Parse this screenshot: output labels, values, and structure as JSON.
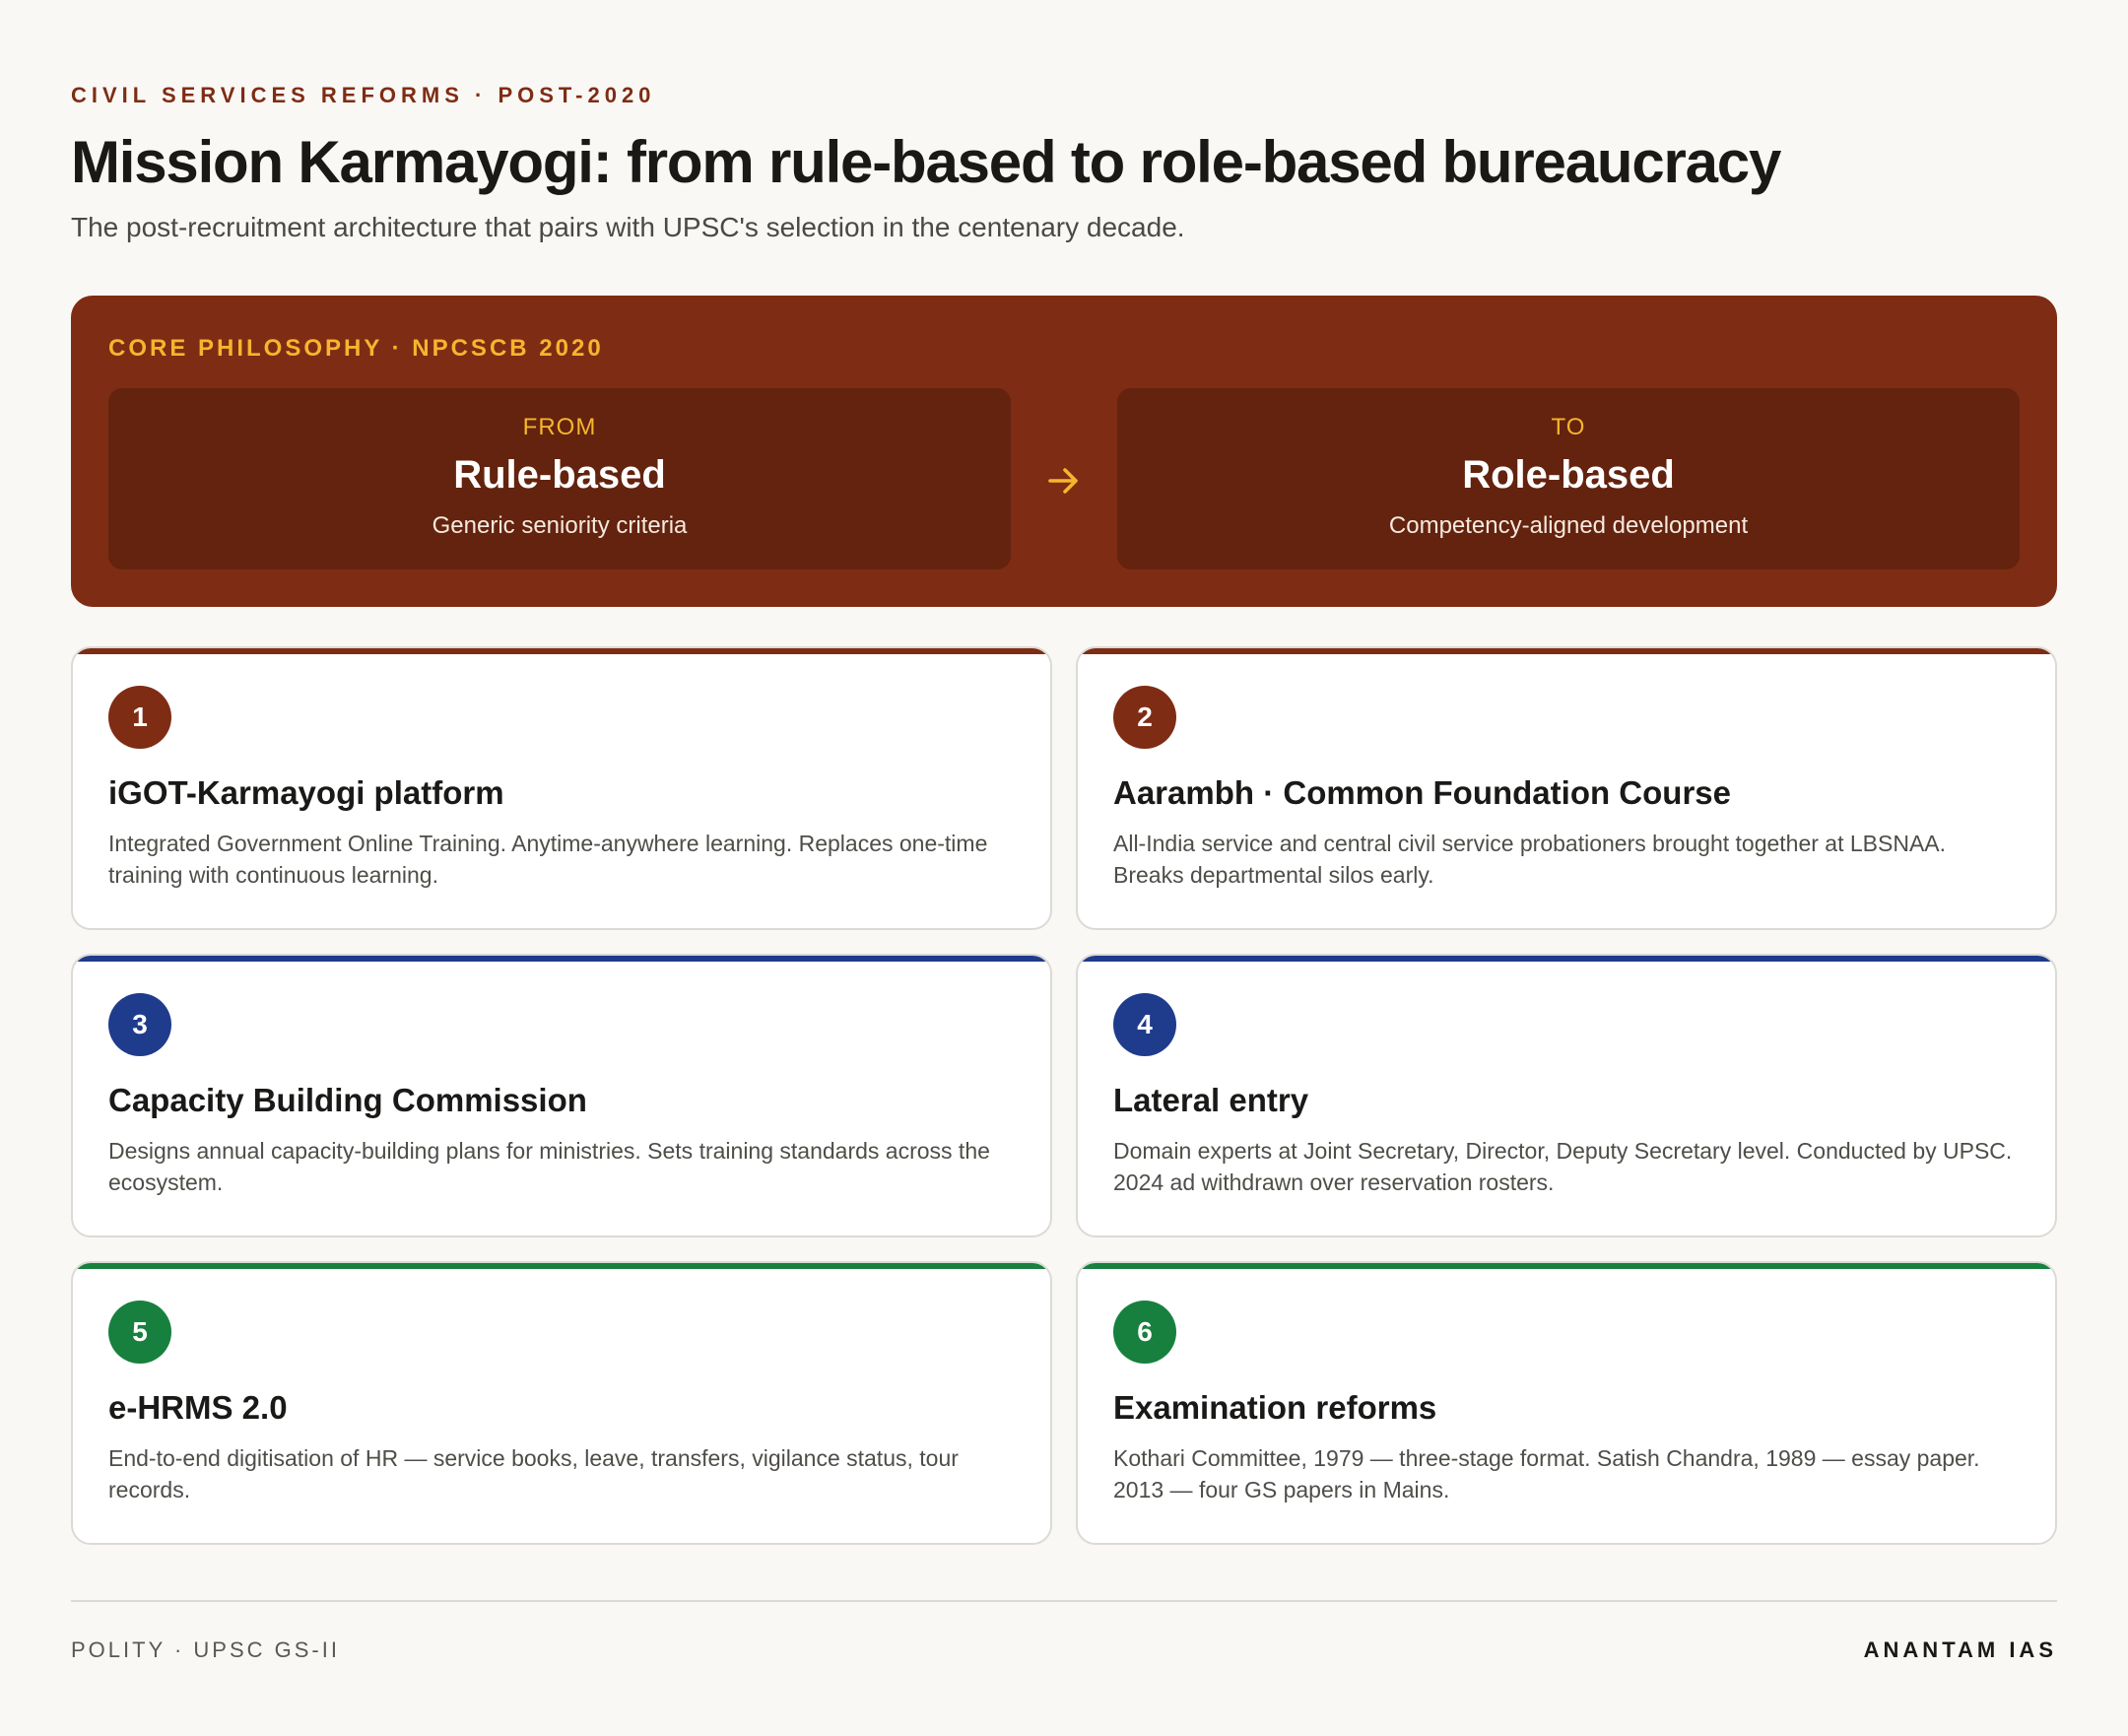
{
  "header": {
    "eyebrow": "CIVIL SERVICES REFORMS · POST-2020",
    "title": "Mission Karmayogi: from rule-based to role-based bureaucracy",
    "subtitle": "The post-recruitment architecture that pairs with UPSC's selection in the centenary decade."
  },
  "banner": {
    "label": "CORE PHILOSOPHY · NPCSCB 2020",
    "from": {
      "tag": "FROM",
      "main": "Rule-based",
      "desc": "Generic seniority criteria"
    },
    "to": {
      "tag": "TO",
      "main": "Role-based",
      "desc": "Competency-aligned development"
    },
    "arrow_icon": "arrow-right-icon"
  },
  "colors": {
    "maroon": "#7f2c14",
    "blue": "#1f3b8c",
    "green": "#17803e",
    "gold": "#f6b52e"
  },
  "cards": [
    {
      "num": "1",
      "title": "iGOT-Karmayogi platform",
      "desc": "Integrated Government Online Training. Anytime-anywhere learning. Replaces one-time training with continuous learning.",
      "accent": "#7f2c14"
    },
    {
      "num": "2",
      "title": "Aarambh · Common Foundation Course",
      "desc": "All-India service and central civil service probationers brought together at LBSNAA. Breaks departmental silos early.",
      "accent": "#7f2c14"
    },
    {
      "num": "3",
      "title": "Capacity Building Commission",
      "desc": "Designs annual capacity-building plans for ministries. Sets training standards across the ecosystem.",
      "accent": "#1f3b8c"
    },
    {
      "num": "4",
      "title": "Lateral entry",
      "desc": "Domain experts at Joint Secretary, Director, Deputy Secretary level. Conducted by UPSC. 2024 ad withdrawn over reservation rosters.",
      "accent": "#1f3b8c"
    },
    {
      "num": "5",
      "title": "e-HRMS 2.0",
      "desc": "End-to-end digitisation of HR — service books, leave, transfers, vigilance status, tour records.",
      "accent": "#17803e"
    },
    {
      "num": "6",
      "title": "Examination reforms",
      "desc": "Kothari Committee, 1979 — three-stage format. Satish Chandra, 1989 — essay paper. 2013 — four GS papers in Mains.",
      "accent": "#17803e"
    }
  ],
  "footer": {
    "left": "POLITY · UPSC GS-II",
    "right": "ANANTAM IAS"
  }
}
